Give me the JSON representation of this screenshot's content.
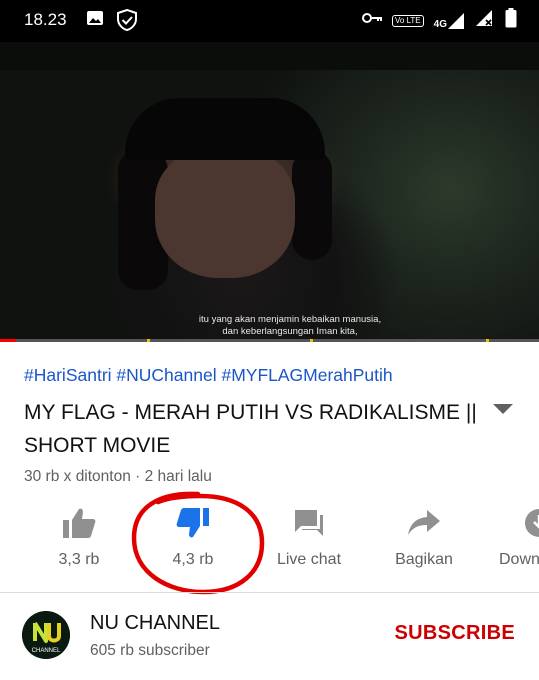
{
  "status_bar": {
    "time": "18.23",
    "icons": [
      "image-icon",
      "shield-check-icon",
      "key-icon",
      "volte-icon",
      "network-4g-icon",
      "signal-icon",
      "signal-no-sim-icon",
      "battery-icon"
    ],
    "volte_label": "Vo LTE",
    "network_label": "4G"
  },
  "video": {
    "subtitle_line1": "itu yang akan menjamin kebaikan manusia,",
    "subtitle_line2": "dan keberlangsungan Iman kita,",
    "progress_fraction": 0.03
  },
  "video_info": {
    "hashtags": "#HariSantri #NUChannel #MYFLAGMerahPutih",
    "title": "MY FLAG - MERAH PUTIH VS RADIKALISME || SHORT MOVIE",
    "meta": "30 rb x ditonton · 2 hari lalu"
  },
  "actions": [
    {
      "name": "like",
      "label": "3,3 rb",
      "icon": "thumbs-up-icon"
    },
    {
      "name": "dislike",
      "label": "4,3 rb",
      "icon": "thumbs-down-icon",
      "active": true
    },
    {
      "name": "live-chat",
      "label": "Live chat",
      "icon": "chat-icon"
    },
    {
      "name": "share",
      "label": "Bagikan",
      "icon": "share-icon"
    },
    {
      "name": "download",
      "label": "Down",
      "icon": "download-icon"
    }
  ],
  "channel": {
    "name": "NU CHANNEL",
    "subscribers": "605 rb subscriber",
    "subscribe_label": "SUBSCRIBE",
    "avatar_text": "CHANNEL"
  },
  "colors": {
    "accent_blue": "#1a56c8",
    "subscribe_red": "#cc0000",
    "dislike_active": "#1a73e8",
    "annotation_red": "#e00000"
  }
}
